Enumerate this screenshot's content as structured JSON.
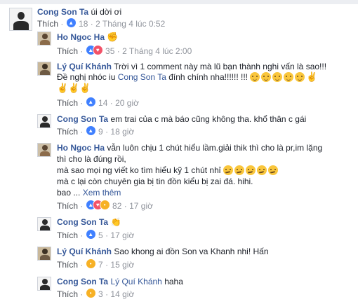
{
  "comments": [
    {
      "id": "c1",
      "author": "Cong Son Ta",
      "text": "úi dời ơi",
      "like_label": "Thích",
      "reaction_count": "18",
      "time": "2 Tháng 4 lúc 0:52"
    },
    {
      "id": "c2",
      "author": "Ho Ngoc Ha",
      "text": "",
      "emoji": "fist-bump-emoji",
      "like_label": "Thích",
      "reaction_count": "35",
      "time": "2 Tháng 4 lúc 2:00"
    },
    {
      "id": "c3",
      "author": "Lý Quí Khánh",
      "text_line1": "Trời vì 1 comment này mà lũ bạn thành nghi vấn là sao!!!",
      "text_line2_prefix": "Đề nghị nhóc iu",
      "text_line2_mention": "Cong Son Ta",
      "text_line2_suffix": "đính chính nha!!!!!! !!!",
      "like_label": "Thích",
      "reaction_count": "14",
      "time": "20 giờ"
    },
    {
      "id": "c4",
      "author": "Cong Son Ta",
      "text": "em trai của c mà báo cũng không tha. khổ thân c gái",
      "like_label": "Thích",
      "reaction_count": "9",
      "time": "18 giờ"
    },
    {
      "id": "c5",
      "author": "Ho Ngoc Ha",
      "text_line1": "vẫn luôn chịu 1 chút hiểu lầm.giải thik thì cho là pr,im lặng",
      "text_line2": "thì cho là đúng rồi,",
      "text_line3": "mà sao mọi ng viết ko tìm hiểu kỹ 1 chút nhỉ",
      "text_line4": "mà c lại còn chuyên gia bị tin đồn kiểu bị zai đá. hihi.",
      "text_line5": "bao ...",
      "see_more": "Xem thêm",
      "like_label": "Thích",
      "reaction_count": "82",
      "time": "17 giờ"
    },
    {
      "id": "c6",
      "author": "Cong Son Ta",
      "text": "",
      "like_label": "Thích",
      "reaction_count": "5",
      "time": "17 giờ"
    },
    {
      "id": "c7",
      "author": "Lý Quí Khánh",
      "text": "Sao khong ai đồn Son va Khanh nhi! Hấn",
      "like_label": "Thích",
      "reaction_count": "7",
      "time": "15 giờ"
    },
    {
      "id": "c8",
      "author": "Cong Son Ta",
      "mention": "Lý Quí Khánh",
      "text": "haha",
      "like_label": "Thích",
      "reaction_count": "3",
      "time": "14 giờ"
    }
  ],
  "colors": {
    "name": "#365899",
    "meta": "#90949c",
    "like_reaction": "#4080ff",
    "love_reaction": "#f25268",
    "haha_reaction": "#f7b125"
  }
}
